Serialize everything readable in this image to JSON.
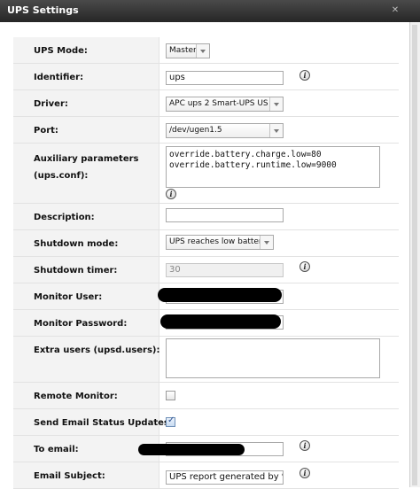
{
  "window": {
    "title": "UPS Settings"
  },
  "form": {
    "ups_mode": {
      "label": "UPS Mode:",
      "value": "Master"
    },
    "identifier": {
      "label": "Identifier:",
      "value": "ups"
    },
    "driver": {
      "label": "Driver:",
      "value": "APC ups 2 Smart-UPS US"
    },
    "port": {
      "label": "Port:",
      "value": "/dev/ugen1.5"
    },
    "auxiliary": {
      "label_line1": "Auxiliary parameters",
      "label_line2": "(ups.conf):",
      "line1": "override.battery.charge.low=80",
      "line2": "override.battery.runtime.low=9000"
    },
    "description": {
      "label": "Description:",
      "value": ""
    },
    "shutdown_mode": {
      "label": "Shutdown mode:",
      "value": "UPS reaches low battery"
    },
    "shutdown_timer": {
      "label": "Shutdown timer:",
      "value": "30"
    },
    "monitor_user": {
      "label": "Monitor User:"
    },
    "monitor_password": {
      "label": "Monitor Password:"
    },
    "extra_users": {
      "label": "Extra users (upsd.users):",
      "value": ""
    },
    "remote_monitor": {
      "label": "Remote Monitor:",
      "checked": false
    },
    "send_email": {
      "label": "Send Email Status Updates:",
      "checked": true
    },
    "to_email": {
      "label": "To email:"
    },
    "email_subject": {
      "label": "Email Subject:",
      "value": "UPS report generated by %l"
    }
  },
  "icons": {
    "info": "info-icon",
    "close": "close-icon"
  },
  "colors": {
    "titlebar": "#333333",
    "label_bg": "#f3f3f3",
    "border": "#e2e2e2"
  }
}
